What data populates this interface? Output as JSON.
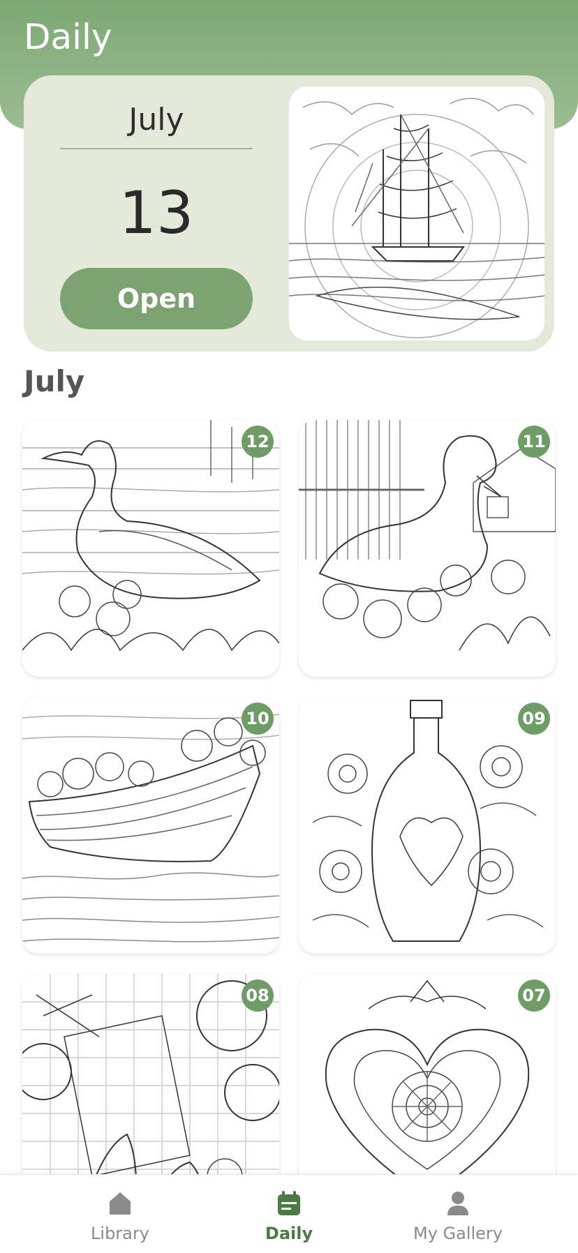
{
  "header": {
    "title": "Daily"
  },
  "daily_card": {
    "month": "July",
    "day": "13",
    "open_label": "Open"
  },
  "section": {
    "title": "July"
  },
  "grid": {
    "tiles": [
      {
        "day": "12",
        "subject": "duck with ducklings"
      },
      {
        "day": "11",
        "subject": "swan with chicks and house"
      },
      {
        "day": "10",
        "subject": "boat with sunflowers"
      },
      {
        "day": "09",
        "subject": "bottle with flowers and heart"
      },
      {
        "day": "08",
        "subject": "knitting with yarn balls"
      },
      {
        "day": "07",
        "subject": "mandala heart"
      }
    ]
  },
  "bottom_nav": {
    "items": [
      {
        "label": "Library",
        "icon": "home-icon",
        "active": false
      },
      {
        "label": "Daily",
        "icon": "calendar-icon",
        "active": true
      },
      {
        "label": "My Gallery",
        "icon": "user-icon",
        "active": false
      }
    ]
  },
  "colors": {
    "accent": "#7ca271",
    "header": "#8cb282",
    "card": "#e3e8d9",
    "badge": "#6f9c66"
  }
}
